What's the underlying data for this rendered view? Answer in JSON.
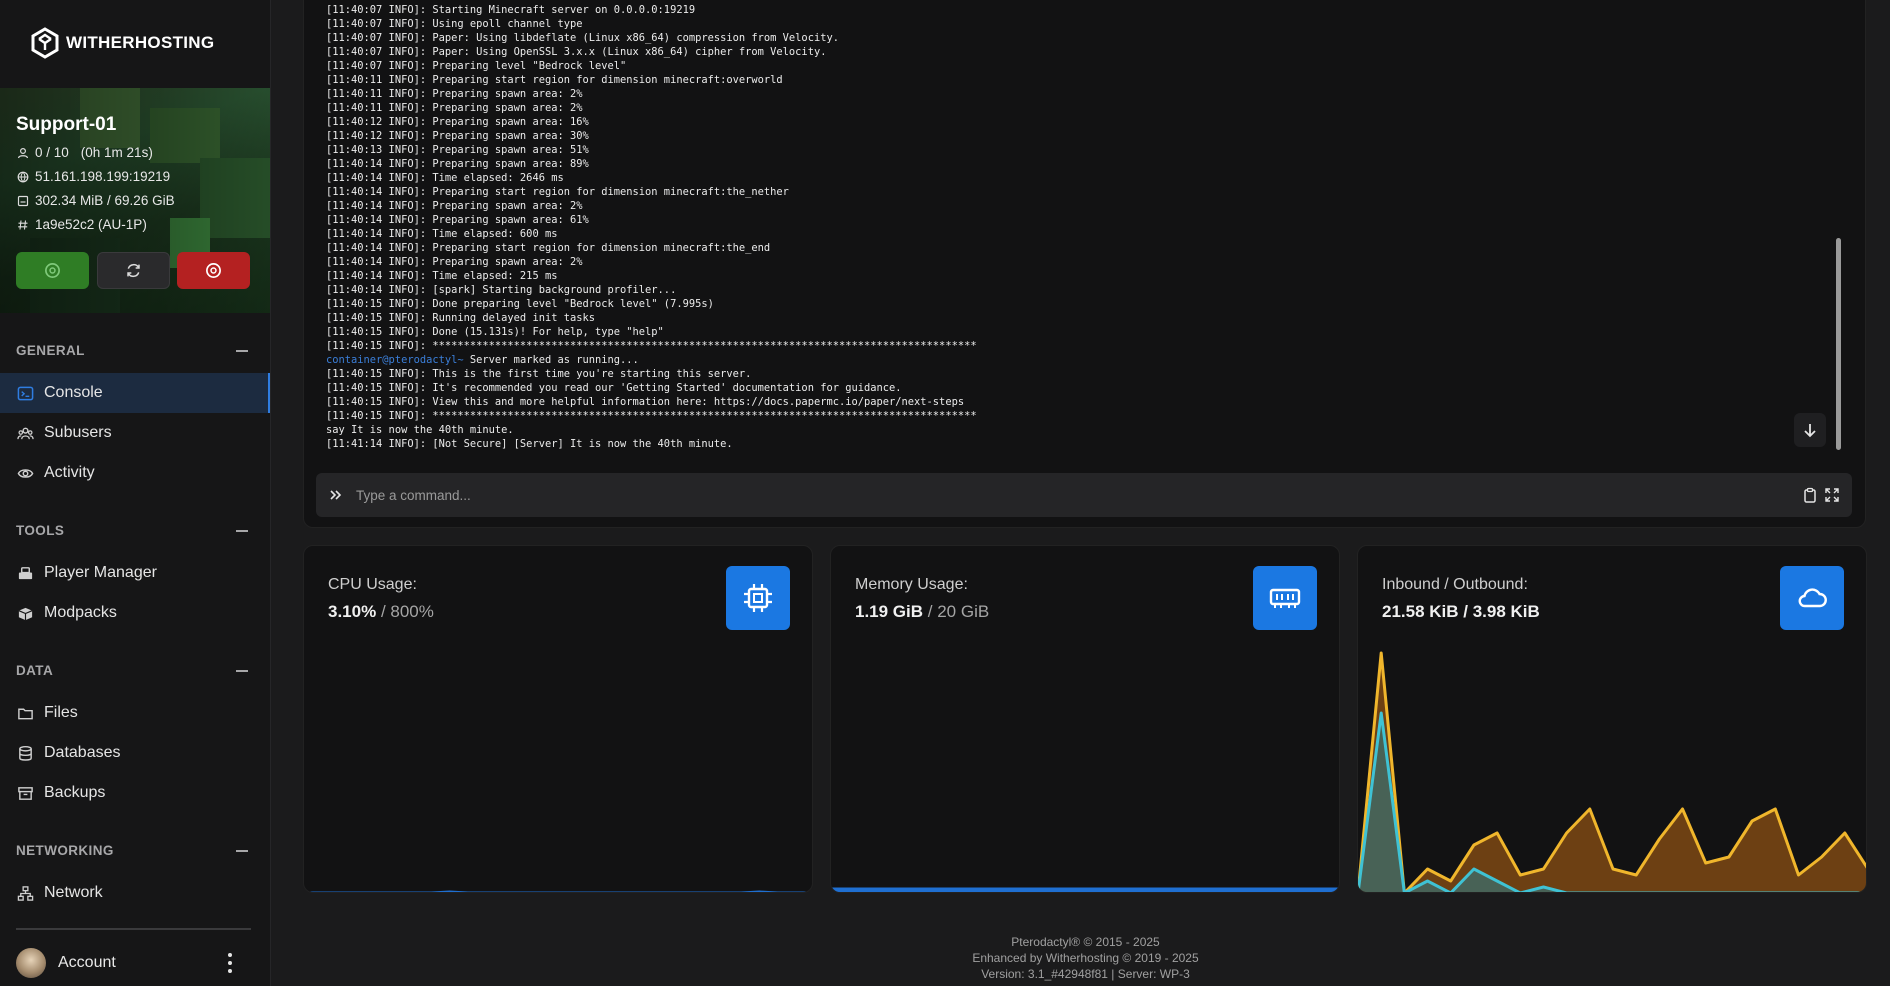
{
  "brand": {
    "name": "WITHERHOSTING"
  },
  "server": {
    "name": "Support-01",
    "players": "0 / 10",
    "uptime": "(0h 1m 21s)",
    "address": "51.161.198.199:19219",
    "usage": "302.34 MiB / 69.26 GiB",
    "id": "1a9e52c2 (AU-1P)",
    "colors": {
      "start": "#2f7d25",
      "restart": "#2a2a2c",
      "stop": "#b42121"
    }
  },
  "sidebar": {
    "sections": [
      {
        "title": "GENERAL",
        "items": [
          {
            "label": "Console",
            "icon": "terminal-icon",
            "active": true
          },
          {
            "label": "Subusers",
            "icon": "users-icon"
          },
          {
            "label": "Activity",
            "icon": "eye-icon"
          }
        ]
      },
      {
        "title": "TOOLS",
        "items": [
          {
            "label": "Player Manager",
            "icon": "player-manager-icon"
          },
          {
            "label": "Modpacks",
            "icon": "modpacks-icon"
          }
        ]
      },
      {
        "title": "DATA",
        "items": [
          {
            "label": "Files",
            "icon": "folder-icon"
          },
          {
            "label": "Databases",
            "icon": "database-icon"
          },
          {
            "label": "Backups",
            "icon": "archive-icon"
          }
        ]
      },
      {
        "title": "NETWORKING",
        "items": [
          {
            "label": "Network",
            "icon": "network-icon"
          }
        ]
      }
    ],
    "account": {
      "label": "Account"
    }
  },
  "console": {
    "lines": [
      "[11:40:07 INFO]: Starting Minecraft server on 0.0.0.0:19219",
      "[11:40:07 INFO]: Using epoll channel type",
      "[11:40:07 INFO]: Paper: Using libdeflate (Linux x86_64) compression from Velocity.",
      "[11:40:07 INFO]: Paper: Using OpenSSL 3.x.x (Linux x86_64) cipher from Velocity.",
      "[11:40:07 INFO]: Preparing level \"Bedrock level\"",
      "[11:40:11 INFO]: Preparing start region for dimension minecraft:overworld",
      "[11:40:11 INFO]: Preparing spawn area: 2%",
      "[11:40:11 INFO]: Preparing spawn area: 2%",
      "[11:40:12 INFO]: Preparing spawn area: 16%",
      "[11:40:12 INFO]: Preparing spawn area: 30%",
      "[11:40:13 INFO]: Preparing spawn area: 51%",
      "[11:40:14 INFO]: Preparing spawn area: 89%",
      "[11:40:14 INFO]: Time elapsed: 2646 ms",
      "[11:40:14 INFO]: Preparing start region for dimension minecraft:the_nether",
      "[11:40:14 INFO]: Preparing spawn area: 2%",
      "[11:40:14 INFO]: Preparing spawn area: 61%",
      "[11:40:14 INFO]: Time elapsed: 600 ms",
      "[11:40:14 INFO]: Preparing start region for dimension minecraft:the_end",
      "[11:40:14 INFO]: Preparing spawn area: 2%",
      "[11:40:14 INFO]: Time elapsed: 215 ms",
      "[11:40:14 INFO]: [spark] Starting background profiler...",
      "[11:40:15 INFO]: Done preparing level \"Bedrock level\" (7.995s)",
      "[11:40:15 INFO]: Running delayed init tasks",
      "[11:40:15 INFO]: Done (15.131s)! For help, type \"help\"",
      "[11:40:15 INFO]: ***************************************************************************************",
      "container@pterodactyl~ Server marked as running...",
      "[11:40:15 INFO]: This is the first time you're starting this server.",
      "[11:40:15 INFO]: It's recommended you read our 'Getting Started' documentation for guidance.",
      "[11:40:15 INFO]: View this and more helpful information here: https://docs.papermc.io/paper/next-steps",
      "[11:40:15 INFO]: ***************************************************************************************",
      "say It is now the 40th minute.",
      "[11:41:14 INFO]: [Not Secure] [Server] It is now the 40th minute."
    ],
    "prompt_prefix": "container@pterodactyl~",
    "placeholder": "Type a command..."
  },
  "stats": {
    "cpu": {
      "label": "CPU Usage:",
      "value": "3.10%",
      "limit": "/ 800%",
      "icon": "cpu-icon"
    },
    "memory": {
      "label": "Memory Usage:",
      "value": "1.19 GiB",
      "limit": "/ 20 GiB",
      "icon": "memory-icon"
    },
    "network": {
      "label": "Inbound / Outbound:",
      "value": "21.58 KiB / 3.98 KiB",
      "icon": "cloud-icon"
    }
  },
  "chart_data": [
    {
      "type": "area",
      "series": [
        {
          "values": [
            0,
            0,
            0,
            0,
            0,
            0,
            0,
            0,
            0.4,
            0,
            0,
            0,
            0,
            0,
            0,
            0,
            0,
            0,
            0,
            0,
            0,
            0,
            0,
            0,
            0,
            0.4,
            0,
            0,
            0
          ]
        }
      ],
      "color": "#1f6fd1"
    },
    {
      "type": "area",
      "series": [
        {
          "values": [
            1,
            1,
            1,
            1,
            1,
            1,
            1,
            1,
            1,
            1,
            1,
            1,
            1,
            1,
            1,
            1,
            1,
            1,
            1,
            1,
            1,
            1,
            1,
            1,
            1,
            1,
            1,
            1,
            1
          ]
        }
      ],
      "color": "#1f6fd1"
    },
    {
      "type": "area",
      "series": [
        {
          "values": [
            0,
            40,
            0,
            4,
            2,
            8,
            10,
            3,
            4,
            10,
            14,
            4,
            3,
            9,
            14,
            5,
            6,
            12,
            14,
            3,
            6,
            10,
            4
          ],
          "color": "#f0b62c"
        },
        {
          "values": [
            0,
            30,
            0,
            2,
            0,
            4,
            2,
            0,
            1,
            0,
            0,
            0,
            0,
            0,
            0,
            0,
            0,
            0,
            0,
            0,
            0,
            0,
            0
          ],
          "color": "#3fc2d4"
        }
      ]
    }
  ],
  "footer": {
    "line1": "Pterodactyl® © 2015 - 2025",
    "line2": "Enhanced by Witherhosting © 2019 - 2025",
    "line3": "Version: 3.1_#42948f81 | Server: WP-3"
  }
}
